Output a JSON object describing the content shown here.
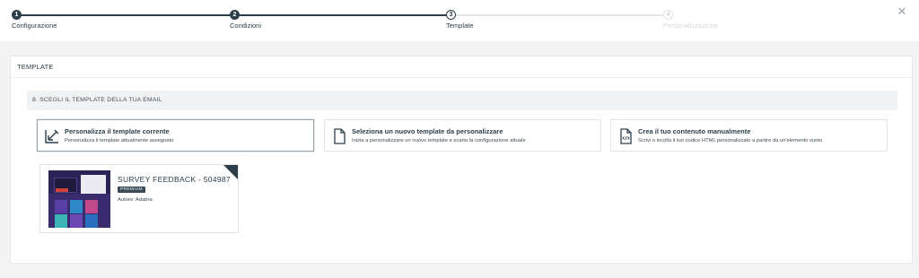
{
  "stepper": {
    "steps": [
      {
        "number": "1",
        "label": "Configurazione",
        "state": "done"
      },
      {
        "number": "2",
        "label": "Condizioni",
        "state": "done"
      },
      {
        "number": "3",
        "label": "Template",
        "state": "current"
      },
      {
        "number": "4",
        "label": "Personalizzazione",
        "state": "todo"
      }
    ],
    "close_icon": "close-icon",
    "close_glyph": "✕"
  },
  "panel": {
    "header": "TEMPLATE",
    "section_title": "8. SCEGLI IL TEMPLATE DELLA TUA EMAIL",
    "options": [
      {
        "title": "Personalizza il template corrente",
        "description": "Personalizza il template attualmente assegnato",
        "icon": "edit-arrow-icon",
        "selected": true
      },
      {
        "title": "Seleziona un nuovo template da personalizzare",
        "description": "Inizia a personalizzare un nuovo template e scarta la configurazione attuale",
        "icon": "blank-document-icon",
        "selected": false
      },
      {
        "title": "Crea il tuo contenuto manualmente",
        "description": "Scrivi o incolla il tuo codice HTML personalizzato a partire da un'elemento vuoto",
        "icon": "code-document-icon",
        "selected": false
      }
    ],
    "template_card": {
      "title": "SURVEY FEEDBACK - 504987",
      "badge": "PREMIUM",
      "author": "Autore: Adabra"
    }
  },
  "colors": {
    "primary": "#2c3e4a",
    "background": "#f3f3f3",
    "inactive": "#d5d9dc"
  }
}
